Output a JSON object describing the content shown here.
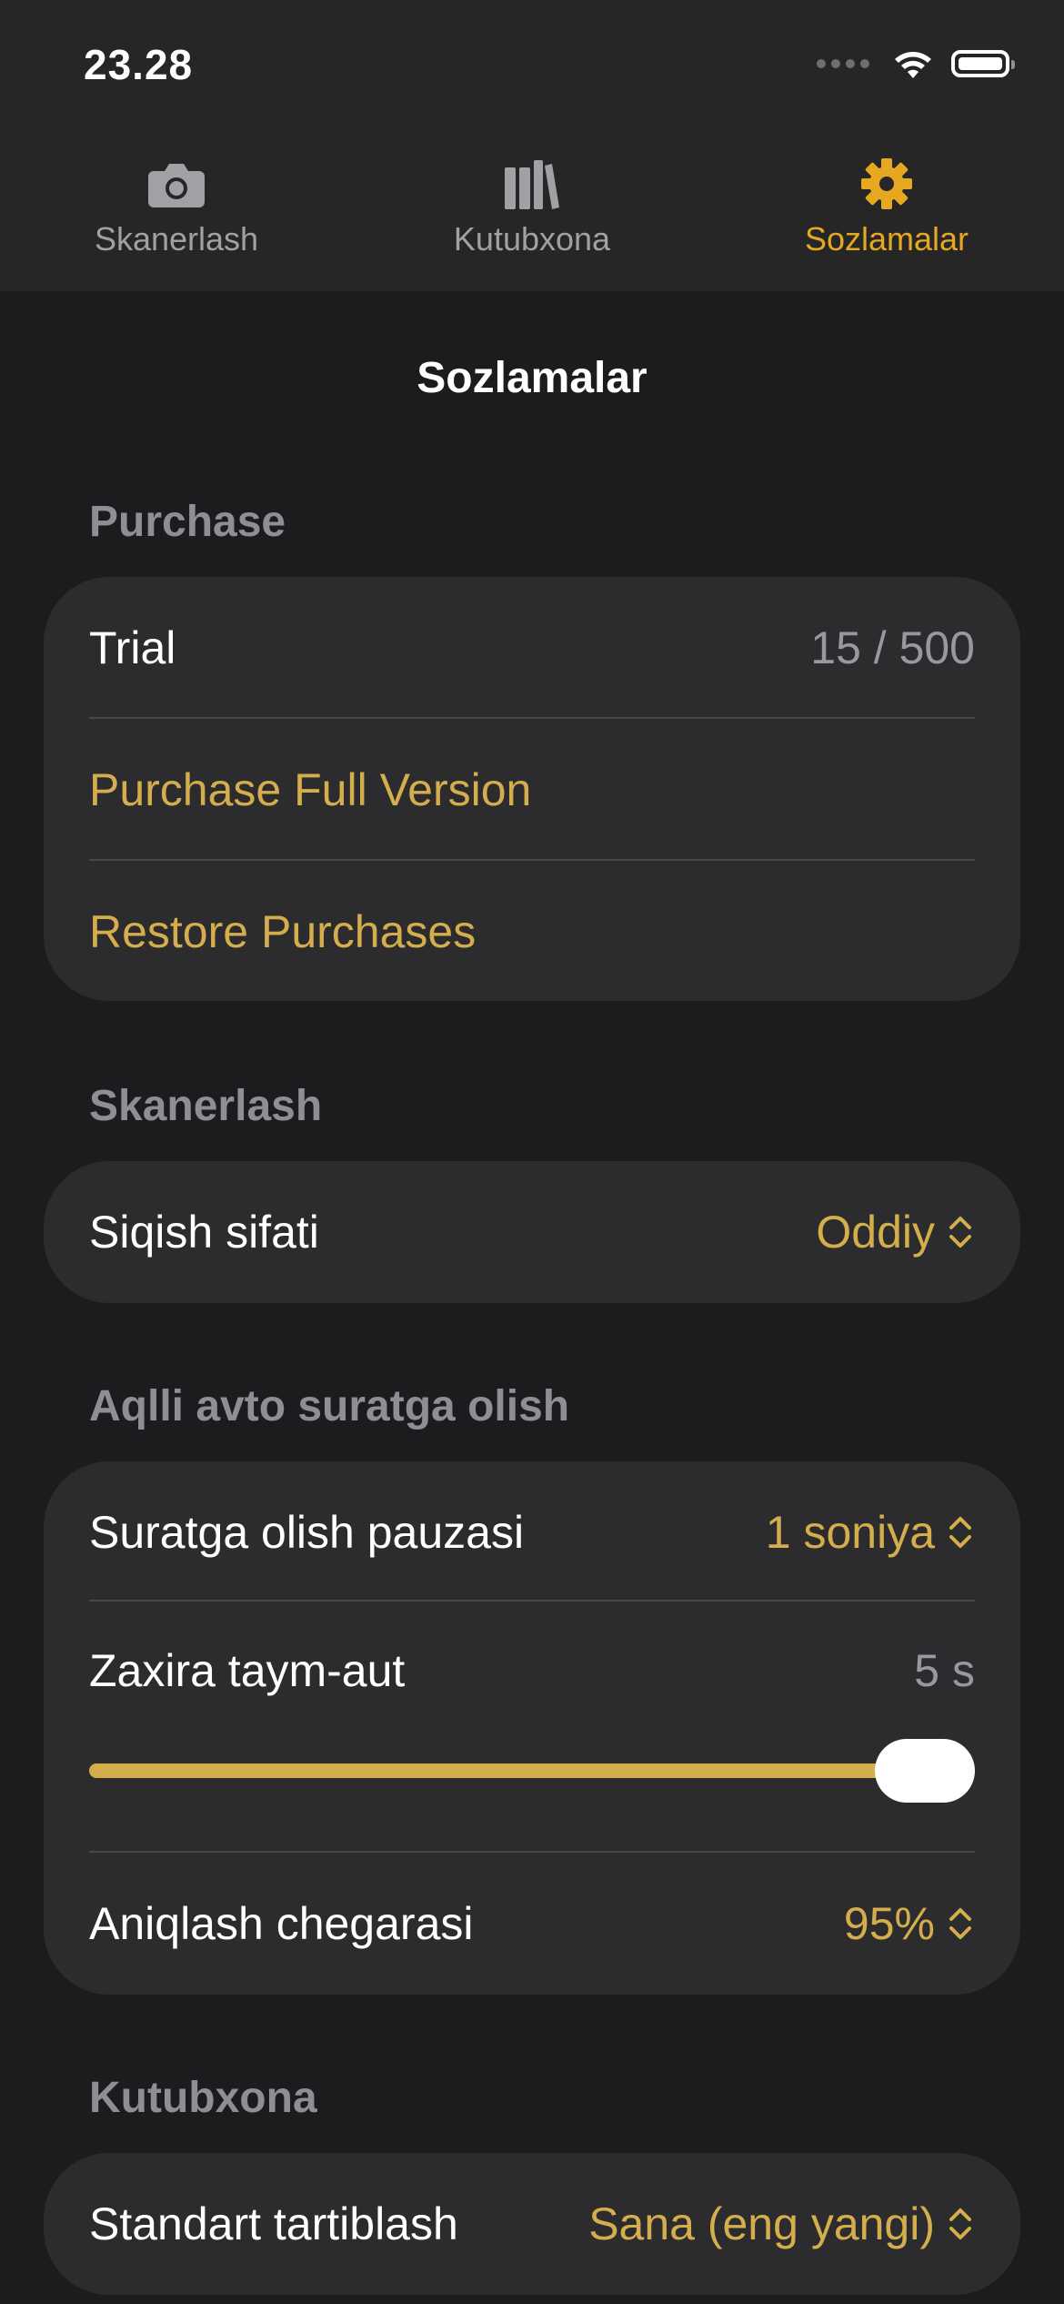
{
  "status_bar": {
    "time": "23.28"
  },
  "tabs": [
    {
      "label": "Skanerlash",
      "icon": "camera-icon",
      "active": false
    },
    {
      "label": "Kutubxona",
      "icon": "library-icon",
      "active": false
    },
    {
      "label": "Sozlamalar",
      "icon": "gear-icon",
      "active": true
    }
  ],
  "colors": {
    "accent": "#d4ae4c",
    "active_tab": "#e6a821",
    "background": "#1c1c1e",
    "card": "#2c2c2e"
  },
  "page_title": "Sozlamalar",
  "purchase": {
    "header": "Purchase",
    "trial_label": "Trial",
    "trial_value": "15 / 500",
    "buy_label": "Purchase Full Version",
    "restore_label": "Restore Purchases"
  },
  "scanning": {
    "header": "Skanerlash",
    "compression_label": "Siqish sifati",
    "compression_value": "Oddiy"
  },
  "smart_capture": {
    "header": "Aqlli avto suratga olish",
    "pause_label": "Suratga olish pauzasi",
    "pause_value": "1 soniya",
    "timeout_label": "Zaxira taym-aut",
    "timeout_value": "5 s",
    "timeout_slider_fraction": 1.0,
    "threshold_label": "Aniqlash chegarasi",
    "threshold_value": "95%"
  },
  "library": {
    "header": "Kutubxona",
    "sort_label": "Standart tartiblash",
    "sort_value": "Sana (eng yangi)"
  }
}
